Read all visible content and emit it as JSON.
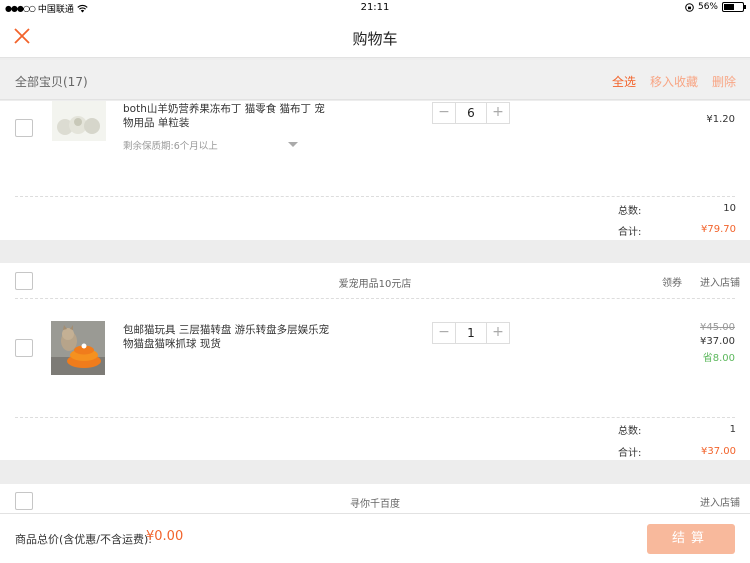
{
  "status_bar": {
    "carrier": "中国联通",
    "time": "21:11",
    "battery": "56%",
    "battery_level": 0.56
  },
  "nav": {
    "title": "购物车",
    "close_icon": "close-icon"
  },
  "toolbar": {
    "count_label": "全部宝贝(17)",
    "select_all": "全选",
    "move_to_favorites": "移入收藏",
    "delete": "删除"
  },
  "item1": {
    "name": "both山羊奶营养果冻布丁 猫零食 猫布丁 宠物用品 单粒装",
    "shelf_life": "剩余保质期:6个月以上",
    "qty": "6",
    "price": "¥1.20",
    "total_count_label": "总数:",
    "total_count": "10",
    "total_label": "合计:",
    "total": "¥79.70"
  },
  "shop2": {
    "name": "爱宠用品10元店",
    "coupon": "领券",
    "enter_shop": "进入店铺"
  },
  "item2": {
    "name": "包邮猫玩具 三层猫转盘 游乐转盘多层娱乐宠物猫盘猫咪抓球 现货",
    "qty": "1",
    "original_price": "¥45.00",
    "price": "¥37.00",
    "savings": "省8.00",
    "total_count_label": "总数:",
    "total_count": "1",
    "total_label": "合计:",
    "total": "¥37.00"
  },
  "shop3": {
    "name": "寻你千百度",
    "enter_shop": "进入店铺"
  },
  "stepper": {
    "minus": "−",
    "plus": "+"
  },
  "footer": {
    "label": "商品总价(含优惠/不含运费):",
    "total": "¥0.00",
    "settle": "结算"
  },
  "colors": {
    "accent": "#f2632b",
    "accent_light": "#f8a584",
    "settle_button": "#f8b99c",
    "savings": "#5cb85c"
  }
}
